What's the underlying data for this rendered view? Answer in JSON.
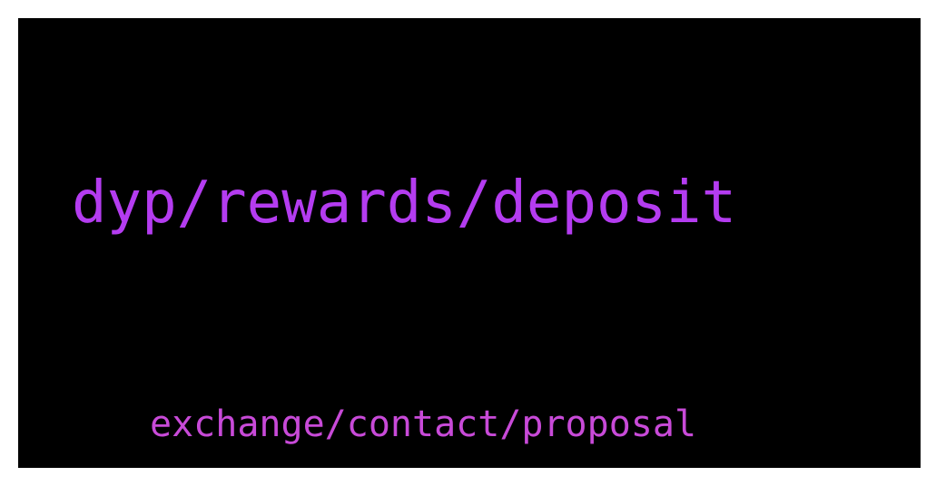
{
  "primary_path": "dyp/rewards/deposit",
  "secondary_path": "exchange/contact/proposal",
  "colors": {
    "background": "#000000",
    "border": "#ffffff",
    "primary_text": "#b43cf0",
    "secondary_text": "#c84ad8"
  }
}
